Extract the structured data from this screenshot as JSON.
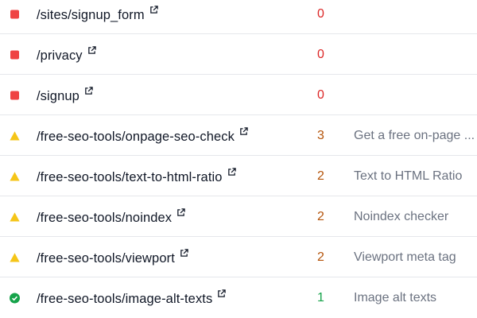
{
  "colors": {
    "error": "#ef4444",
    "warning": "#f5c518",
    "ok": "#16a34a",
    "count_error": "#dc2626",
    "count_warning": "#b45309",
    "count_ok": "#16a34a"
  },
  "rows": [
    {
      "status": "error",
      "path": "/sites/signup_form",
      "count": "0",
      "title": ""
    },
    {
      "status": "error",
      "path": "/privacy",
      "count": "0",
      "title": ""
    },
    {
      "status": "error",
      "path": "/signup",
      "count": "0",
      "title": ""
    },
    {
      "status": "warning",
      "path": "/free-seo-tools/onpage-seo-check",
      "count": "3",
      "title": "Get a free on-page ..."
    },
    {
      "status": "warning",
      "path": "/free-seo-tools/text-to-html-ratio",
      "count": "2",
      "title": "Text to HTML Ratio"
    },
    {
      "status": "warning",
      "path": "/free-seo-tools/noindex",
      "count": "2",
      "title": "Noindex checker"
    },
    {
      "status": "warning",
      "path": "/free-seo-tools/viewport",
      "count": "2",
      "title": "Viewport meta tag"
    },
    {
      "status": "ok",
      "path": "/free-seo-tools/image-alt-texts",
      "count": "1",
      "title": "Image alt texts"
    }
  ]
}
